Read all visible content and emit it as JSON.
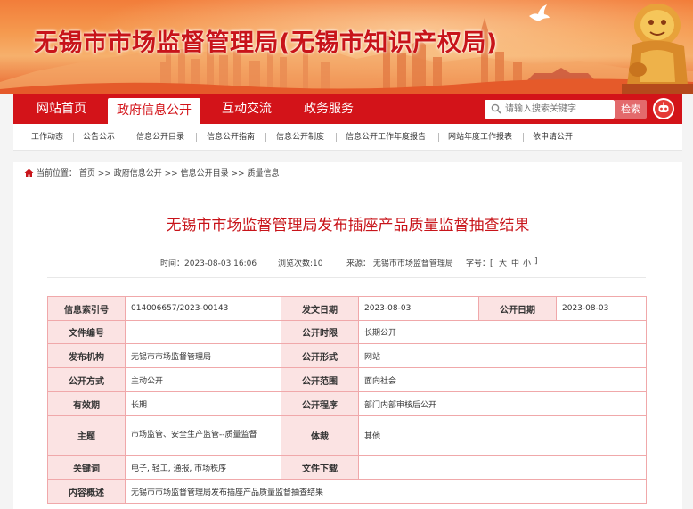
{
  "site": {
    "title": "无锡市市场监督管理局(无锡市知识产权局)"
  },
  "colors": {
    "brand_red": "#d31319",
    "title_red": "#c8141a",
    "label_bg": "#fbe3e3",
    "table_border": "#f0a8aa"
  },
  "nav": {
    "items": [
      {
        "label": "网站首页"
      },
      {
        "label": "政府信息公开"
      },
      {
        "label": "互动交流"
      },
      {
        "label": "政务服务"
      }
    ],
    "search_placeholder": "请输入搜索关键字",
    "search_button": "检索",
    "robot_icon": "robot-assistant-icon"
  },
  "subnav": {
    "items": [
      {
        "label": "工作动态"
      },
      {
        "label": "公告公示"
      },
      {
        "label": "信息公开目录"
      },
      {
        "label": "信息公开指南"
      },
      {
        "label": "信息公开制度"
      },
      {
        "label": "信息公开工作年度报告"
      },
      {
        "label": "网站年度工作报表"
      },
      {
        "label": "依申请公开"
      }
    ]
  },
  "breadcrumb": {
    "prefix": "当前位置：",
    "items": [
      "首页",
      "政府信息公开",
      "信息公开目录",
      "质量信息"
    ],
    "separator": ">>"
  },
  "article": {
    "title": "无锡市市场监督管理局发布插座产品质量监督抽查结果",
    "meta": {
      "time": "时间：2023-08-03 16:06",
      "views": "浏览次数:10",
      "source": "来源：  无锡市市场监督管理局",
      "font_size_label": "字号：[",
      "font_large": "大",
      "font_medium": "中",
      "font_small": "小",
      "font_close": "]"
    }
  },
  "info_table": {
    "index_label": "信息索引号",
    "index_value": "014006657/2023-00143",
    "issue_date_label": "发文日期",
    "issue_date_value": "2023-08-03",
    "publish_date_label": "公开日期",
    "publish_date_value": "2023-08-03",
    "doc_no_label": "文件编号",
    "doc_no_value": "",
    "publish_period_label": "公开时限",
    "publish_period_value": "长期公开",
    "issuer_label": "发布机构",
    "issuer_value": "无锡市市场监督管理局",
    "publish_form_label": "公开形式",
    "publish_form_value": "网站",
    "publish_method_label": "公开方式",
    "publish_method_value": "主动公开",
    "publish_scope_label": "公开范围",
    "publish_scope_value": "面向社会",
    "validity_label": "有效期",
    "validity_value": "长期",
    "procedure_label": "公开程序",
    "procedure_value": "部门内部审核后公开",
    "subject_label": "主题",
    "subject_value": "市场监管、安全生产监管--质量监督",
    "genre_label": "体裁",
    "genre_value": "其他",
    "keywords_label": "关键词",
    "keywords_value": "电子, 轻工, 通报, 市场秩序",
    "attachment_label": "文件下载",
    "attachment_value": "",
    "summary_label": "内容概述",
    "summary_value": "无锡市市场监督管理局发布插座产品质量监督抽查结果"
  }
}
